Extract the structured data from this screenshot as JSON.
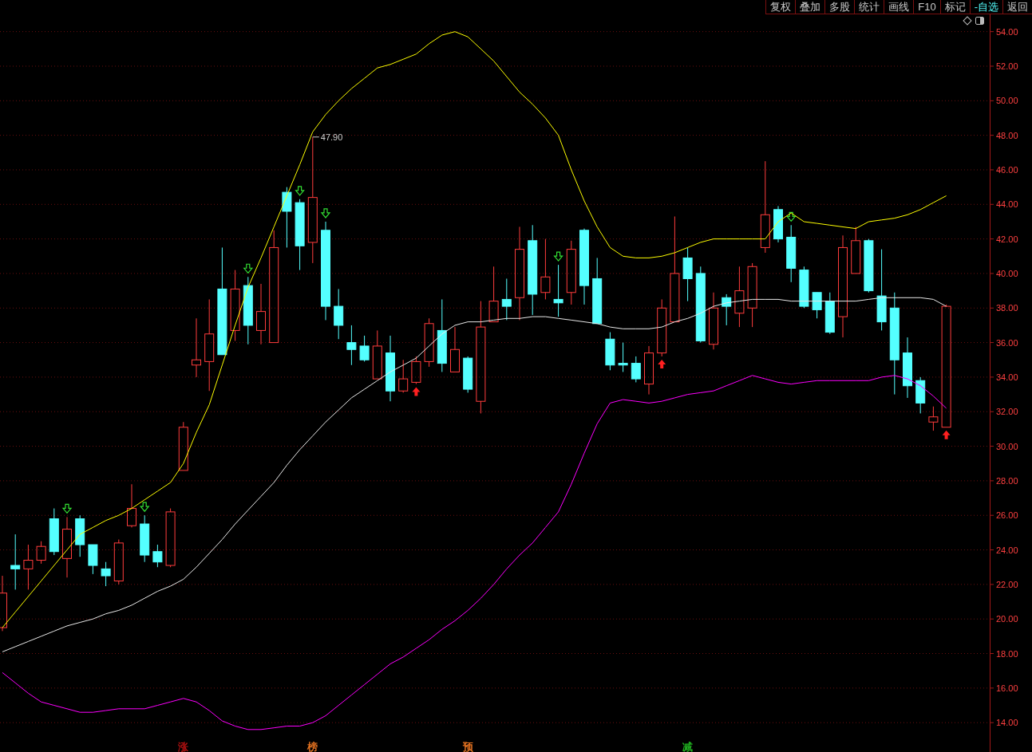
{
  "toolbar": {
    "buttons": [
      {
        "label": "复权",
        "selected": false
      },
      {
        "label": "叠加",
        "selected": false
      },
      {
        "label": "多股",
        "selected": false
      },
      {
        "label": "统计",
        "selected": false
      },
      {
        "label": "画线",
        "selected": false
      },
      {
        "label": "F10",
        "selected": false
      },
      {
        "label": "标记",
        "selected": false
      },
      {
        "label": "-自选",
        "selected": true
      },
      {
        "label": "返回",
        "selected": false
      }
    ]
  },
  "chart_data": {
    "type": "candlestick",
    "ylim": [
      12.3,
      55.0
    ],
    "grid": true,
    "yticks": [
      {
        "value": 54,
        "label": "54.00"
      },
      {
        "value": 52,
        "label": "52.00"
      },
      {
        "value": 50,
        "label": "50.00"
      },
      {
        "value": 48,
        "label": "48.00"
      },
      {
        "value": 46,
        "label": "46.00"
      },
      {
        "value": 44,
        "label": "44.00"
      },
      {
        "value": 42,
        "label": "42.00"
      },
      {
        "value": 40,
        "label": "40.00"
      },
      {
        "value": 38,
        "label": "38.00"
      },
      {
        "value": 36,
        "label": "36.00"
      },
      {
        "value": 34,
        "label": "34.00"
      },
      {
        "value": 32,
        "label": "32.00"
      },
      {
        "value": 30,
        "label": "30.00"
      },
      {
        "value": 28,
        "label": "28.00"
      },
      {
        "value": 26,
        "label": "26.00"
      },
      {
        "value": 24,
        "label": "24.00"
      },
      {
        "value": 22,
        "label": "22.00"
      },
      {
        "value": 20,
        "label": "20.00"
      },
      {
        "value": 18,
        "label": "18.00"
      },
      {
        "value": 16,
        "label": "16.00"
      },
      {
        "value": 14,
        "label": "14.00"
      }
    ],
    "ohlc": [
      [
        19.5,
        22.5,
        19.3,
        21.5
      ],
      [
        23.1,
        24.9,
        21.7,
        22.9
      ],
      [
        22.9,
        24.3,
        21.7,
        23.4
      ],
      [
        23.4,
        24.5,
        23.2,
        24.2
      ],
      [
        25.8,
        26.4,
        23.7,
        23.9
      ],
      [
        23.5,
        25.9,
        22.4,
        25.2
      ],
      [
        25.8,
        26.0,
        23.6,
        24.3
      ],
      [
        24.3,
        24.3,
        22.6,
        23.1
      ],
      [
        22.9,
        23.3,
        21.9,
        22.5
      ],
      [
        22.2,
        24.6,
        22.0,
        24.4
      ],
      [
        25.4,
        27.8,
        25.3,
        26.4
      ],
      [
        25.5,
        26.0,
        23.3,
        23.7
      ],
      [
        23.9,
        24.3,
        23.0,
        23.3
      ],
      [
        23.1,
        26.4,
        23.0,
        26.2
      ],
      [
        28.6,
        31.4,
        28.6,
        31.1
      ],
      [
        34.7,
        37.4,
        34.0,
        35.0
      ],
      [
        34.9,
        38.5,
        33.2,
        36.5
      ],
      [
        39.1,
        41.5,
        35.3,
        35.3
      ],
      [
        36.7,
        40.2,
        36.1,
        39.1
      ],
      [
        39.3,
        39.8,
        35.9,
        37.0
      ],
      [
        36.7,
        39.4,
        35.9,
        37.8
      ],
      [
        36.0,
        42.5,
        36.0,
        41.5
      ],
      [
        44.7,
        45.0,
        41.5,
        43.6
      ],
      [
        44.1,
        44.3,
        40.2,
        41.6
      ],
      [
        41.8,
        47.9,
        40.6,
        44.4
      ],
      [
        42.5,
        43.0,
        37.3,
        38.1
      ],
      [
        38.1,
        39.1,
        36.2,
        37.0
      ],
      [
        36.0,
        37.0,
        34.7,
        35.6
      ],
      [
        35.8,
        36.4,
        34.9,
        35.0
      ],
      [
        33.9,
        36.7,
        33.9,
        35.8
      ],
      [
        35.4,
        36.4,
        32.6,
        33.2
      ],
      [
        33.2,
        35.0,
        33.1,
        33.9
      ],
      [
        33.7,
        35.2,
        33.6,
        34.9
      ],
      [
        34.9,
        37.4,
        34.6,
        37.1
      ],
      [
        36.7,
        38.5,
        34.3,
        34.8
      ],
      [
        34.3,
        36.9,
        34.3,
        35.6
      ],
      [
        35.1,
        35.2,
        33.1,
        33.3
      ],
      [
        32.6,
        38.4,
        31.9,
        36.9
      ],
      [
        37.2,
        40.4,
        37.2,
        38.4
      ],
      [
        38.5,
        39.7,
        37.3,
        38.1
      ],
      [
        38.6,
        42.7,
        37.3,
        41.4
      ],
      [
        41.9,
        42.8,
        37.6,
        38.8
      ],
      [
        38.9,
        42.0,
        38.5,
        39.8
      ],
      [
        38.5,
        40.5,
        37.5,
        38.3
      ],
      [
        38.9,
        41.9,
        38.2,
        41.4
      ],
      [
        42.5,
        42.6,
        38.2,
        39.3
      ],
      [
        39.7,
        40.9,
        37.1,
        37.1
      ],
      [
        36.2,
        36.6,
        34.4,
        34.7
      ],
      [
        34.8,
        36.0,
        34.3,
        34.7
      ],
      [
        34.8,
        35.2,
        33.7,
        33.9
      ],
      [
        33.6,
        35.8,
        33.0,
        35.4
      ],
      [
        35.4,
        38.5,
        35.2,
        38.0
      ],
      [
        37.2,
        43.3,
        37.2,
        40.0
      ],
      [
        40.9,
        41.5,
        38.4,
        39.7
      ],
      [
        40.0,
        40.4,
        36.0,
        36.1
      ],
      [
        35.9,
        38.9,
        35.6,
        38.0
      ],
      [
        38.6,
        38.8,
        37.0,
        38.1
      ],
      [
        37.7,
        40.4,
        36.9,
        39.0
      ],
      [
        38.0,
        40.6,
        36.9,
        40.4
      ],
      [
        41.5,
        46.5,
        41.2,
        43.4
      ],
      [
        43.7,
        43.9,
        41.8,
        42.0
      ],
      [
        42.1,
        42.8,
        39.5,
        40.3
      ],
      [
        40.2,
        40.4,
        38.0,
        38.1
      ],
      [
        38.9,
        38.9,
        37.4,
        37.9
      ],
      [
        38.4,
        38.9,
        36.5,
        36.6
      ],
      [
        37.5,
        42.2,
        36.3,
        41.5
      ],
      [
        40.0,
        42.7,
        40.0,
        41.9
      ],
      [
        41.9,
        42.0,
        38.9,
        39.0
      ],
      [
        38.7,
        41.4,
        36.7,
        37.2
      ],
      [
        38.0,
        38.9,
        33.0,
        35.0
      ],
      [
        35.4,
        36.3,
        32.8,
        33.5
      ],
      [
        33.8,
        34.0,
        31.9,
        32.5
      ],
      [
        31.4,
        32.3,
        30.9,
        31.7
      ],
      [
        31.1,
        38.2,
        31.1,
        38.1
      ]
    ],
    "series": [
      {
        "type": "line",
        "color": "#ffff00",
        "values": [
          19.5,
          20.4,
          21.3,
          22.2,
          23.1,
          24.0,
          24.9,
          25.3,
          25.7,
          26.0,
          26.4,
          26.9,
          27.4,
          27.9,
          29.0,
          30.8,
          32.4,
          34.7,
          37.0,
          39.2,
          40.9,
          42.7,
          44.5,
          46.3,
          48.2,
          49.2,
          50.0,
          50.7,
          51.3,
          51.9,
          52.1,
          52.4,
          52.7,
          53.3,
          53.8,
          54.0,
          53.7,
          53.0,
          52.3,
          51.4,
          50.5,
          49.8,
          49.0,
          48.0,
          46.0,
          44.2,
          42.7,
          41.5,
          41.0,
          40.9,
          40.9,
          41.0,
          41.2,
          41.5,
          41.8,
          42.0,
          42.0,
          42.0,
          42.0,
          42.0,
          43.0,
          43.5,
          43.0,
          42.9,
          42.8,
          42.7,
          42.6,
          43.0,
          43.1,
          43.2,
          43.4,
          43.7,
          44.1,
          44.5
        ]
      },
      {
        "type": "line",
        "color": "#e8e8e8",
        "values": [
          18.1,
          18.4,
          18.7,
          19.0,
          19.3,
          19.6,
          19.8,
          20.0,
          20.3,
          20.5,
          20.8,
          21.2,
          21.6,
          21.9,
          22.3,
          23.0,
          23.8,
          24.6,
          25.5,
          26.3,
          27.1,
          27.9,
          28.9,
          29.8,
          30.6,
          31.4,
          32.1,
          32.8,
          33.3,
          33.8,
          34.3,
          34.7,
          35.1,
          35.8,
          36.5,
          37.0,
          37.2,
          37.2,
          37.3,
          37.4,
          37.4,
          37.5,
          37.5,
          37.4,
          37.3,
          37.2,
          37.1,
          36.9,
          36.8,
          36.8,
          36.8,
          36.9,
          37.2,
          37.4,
          37.7,
          38.1,
          38.3,
          38.4,
          38.5,
          38.5,
          38.5,
          38.4,
          38.4,
          38.4,
          38.4,
          38.4,
          38.4,
          38.5,
          38.6,
          38.6,
          38.6,
          38.6,
          38.5,
          38.1
        ]
      },
      {
        "type": "line",
        "color": "#ff00ff",
        "values": [
          16.9,
          16.3,
          15.7,
          15.2,
          15.0,
          14.8,
          14.6,
          14.6,
          14.7,
          14.8,
          14.8,
          14.8,
          15.0,
          15.2,
          15.4,
          15.2,
          14.7,
          14.1,
          13.8,
          13.6,
          13.6,
          13.7,
          13.8,
          13.8,
          14.0,
          14.4,
          15.0,
          15.6,
          16.2,
          16.8,
          17.4,
          17.8,
          18.3,
          18.8,
          19.4,
          19.9,
          20.5,
          21.2,
          22.0,
          22.9,
          23.7,
          24.4,
          25.3,
          26.2,
          27.8,
          29.6,
          31.3,
          32.5,
          32.7,
          32.6,
          32.5,
          32.6,
          32.8,
          33.0,
          33.1,
          33.2,
          33.5,
          33.8,
          34.1,
          33.9,
          33.7,
          33.6,
          33.7,
          33.8,
          33.8,
          33.8,
          33.8,
          33.8,
          34.0,
          34.1,
          33.9,
          33.5,
          32.9,
          32.2
        ]
      }
    ],
    "annotations": [
      {
        "text": "47.90"
      }
    ]
  },
  "candle_marks": [
    {
      "sell_arrow": false,
      "buy_arrow": false
    },
    {
      "sell_arrow": false,
      "buy_arrow": false
    },
    {
      "sell_arrow": false,
      "buy_arrow": false
    },
    {
      "sell_arrow": false,
      "buy_arrow": false
    },
    {
      "sell_arrow": false,
      "buy_arrow": false
    },
    {
      "sell_arrow": true,
      "buy_arrow": false
    },
    {
      "sell_arrow": false,
      "buy_arrow": false
    },
    {
      "sell_arrow": false,
      "buy_arrow": false
    },
    {
      "sell_arrow": false,
      "buy_arrow": false
    },
    {
      "sell_arrow": false,
      "buy_arrow": false
    },
    {
      "sell_arrow": false,
      "buy_arrow": false
    },
    {
      "sell_arrow": true,
      "buy_arrow": false
    },
    {
      "sell_arrow": false,
      "buy_arrow": false
    },
    {
      "sell_arrow": false,
      "buy_arrow": false
    },
    {
      "sell_arrow": false,
      "buy_arrow": false,
      "event": {
        "text": "涨",
        "color": "#b01010"
      }
    },
    {
      "sell_arrow": false,
      "buy_arrow": false
    },
    {
      "sell_arrow": false,
      "buy_arrow": false
    },
    {
      "sell_arrow": false,
      "buy_arrow": false
    },
    {
      "sell_arrow": false,
      "buy_arrow": false
    },
    {
      "sell_arrow": true,
      "buy_arrow": false
    },
    {
      "sell_arrow": false,
      "buy_arrow": false
    },
    {
      "sell_arrow": false,
      "buy_arrow": false
    },
    {
      "sell_arrow": false,
      "buy_arrow": false
    },
    {
      "sell_arrow": true,
      "buy_arrow": false
    },
    {
      "sell_arrow": false,
      "buy_arrow": false,
      "event": {
        "text": "榜",
        "color": "#e07020"
      }
    },
    {
      "sell_arrow": true,
      "buy_arrow": false
    },
    {
      "sell_arrow": false,
      "buy_arrow": false
    },
    {
      "sell_arrow": false,
      "buy_arrow": false
    },
    {
      "sell_arrow": false,
      "buy_arrow": false
    },
    {
      "sell_arrow": false,
      "buy_arrow": false
    },
    {
      "sell_arrow": false,
      "buy_arrow": false
    },
    {
      "sell_arrow": false,
      "buy_arrow": false
    },
    {
      "sell_arrow": false,
      "buy_arrow": true
    },
    {
      "sell_arrow": false,
      "buy_arrow": false
    },
    {
      "sell_arrow": false,
      "buy_arrow": false
    },
    {
      "sell_arrow": false,
      "buy_arrow": false
    },
    {
      "sell_arrow": false,
      "buy_arrow": false,
      "event": {
        "text": "预",
        "color": "#e07020"
      }
    },
    {
      "sell_arrow": false,
      "buy_arrow": false
    },
    {
      "sell_arrow": false,
      "buy_arrow": false
    },
    {
      "sell_arrow": false,
      "buy_arrow": false
    },
    {
      "sell_arrow": false,
      "buy_arrow": false
    },
    {
      "sell_arrow": false,
      "buy_arrow": false
    },
    {
      "sell_arrow": false,
      "buy_arrow": false
    },
    {
      "sell_arrow": true,
      "buy_arrow": false
    },
    {
      "sell_arrow": false,
      "buy_arrow": false
    },
    {
      "sell_arrow": false,
      "buy_arrow": false
    },
    {
      "sell_arrow": false,
      "buy_arrow": false
    },
    {
      "sell_arrow": false,
      "buy_arrow": false
    },
    {
      "sell_arrow": false,
      "buy_arrow": false
    },
    {
      "sell_arrow": false,
      "buy_arrow": false
    },
    {
      "sell_arrow": false,
      "buy_arrow": false
    },
    {
      "sell_arrow": false,
      "buy_arrow": true
    },
    {
      "sell_arrow": false,
      "buy_arrow": false
    },
    {
      "sell_arrow": false,
      "buy_arrow": false,
      "event": {
        "text": "减",
        "color": "#20b020"
      }
    },
    {
      "sell_arrow": false,
      "buy_arrow": false
    },
    {
      "sell_arrow": false,
      "buy_arrow": false
    },
    {
      "sell_arrow": false,
      "buy_arrow": false
    },
    {
      "sell_arrow": false,
      "buy_arrow": false
    },
    {
      "sell_arrow": false,
      "buy_arrow": false
    },
    {
      "sell_arrow": false,
      "buy_arrow": false
    },
    {
      "sell_arrow": false,
      "buy_arrow": false
    },
    {
      "sell_arrow": true,
      "buy_arrow": false
    },
    {
      "sell_arrow": false,
      "buy_arrow": false
    },
    {
      "sell_arrow": false,
      "buy_arrow": false
    },
    {
      "sell_arrow": false,
      "buy_arrow": false
    },
    {
      "sell_arrow": false,
      "buy_arrow": false
    },
    {
      "sell_arrow": false,
      "buy_arrow": false
    },
    {
      "sell_arrow": false,
      "buy_arrow": false
    },
    {
      "sell_arrow": false,
      "buy_arrow": false
    },
    {
      "sell_arrow": false,
      "buy_arrow": false
    },
    {
      "sell_arrow": false,
      "buy_arrow": false
    },
    {
      "sell_arrow": false,
      "buy_arrow": false
    },
    {
      "sell_arrow": false,
      "buy_arrow": false
    },
    {
      "sell_arrow": false,
      "buy_arrow": true
    }
  ]
}
